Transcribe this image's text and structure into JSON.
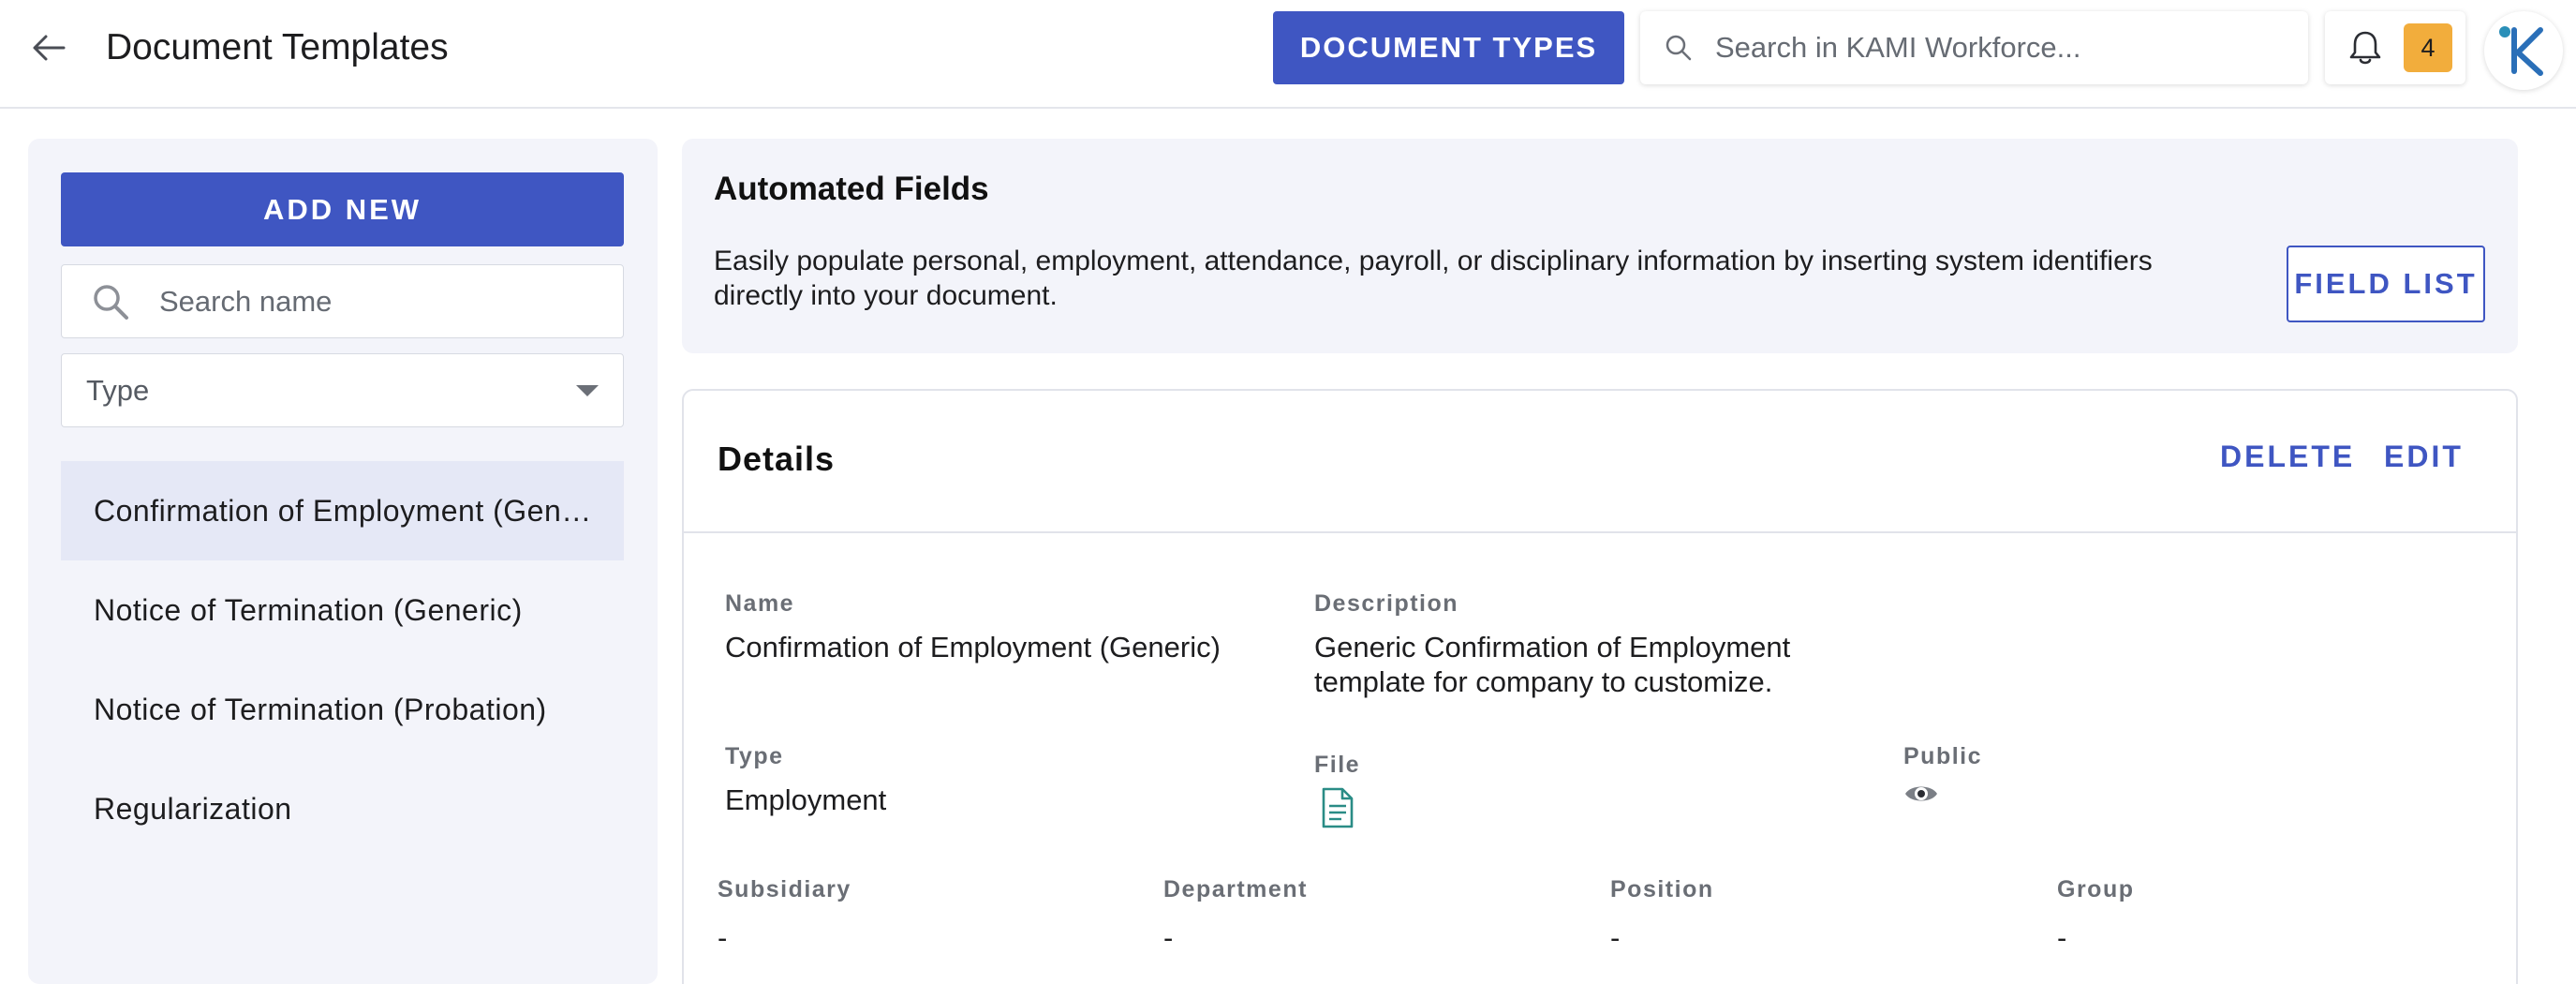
{
  "header": {
    "title": "Document Templates",
    "doc_types_label": "DOCUMENT TYPES",
    "search_placeholder": "Search in KAMI Workforce...",
    "notification_count": "4"
  },
  "sidebar": {
    "add_new_label": "ADD NEW",
    "search_placeholder": "Search name",
    "type_filter_label": "Type",
    "templates": [
      {
        "label": "Confirmation of Employment (Generic)",
        "active": true
      },
      {
        "label": "Notice of Termination (Generic)",
        "active": false
      },
      {
        "label": "Notice of Termination (Probation)",
        "active": false
      },
      {
        "label": "Regularization",
        "active": false
      }
    ]
  },
  "automated_fields": {
    "title": "Automated Fields",
    "description": "Easily populate personal, employment, attendance, payroll, or disciplinary information by inserting system identifiers directly into your document.",
    "field_list_label": "FIELD LIST"
  },
  "details": {
    "title": "Details",
    "delete_label": "DELETE",
    "edit_label": "EDIT",
    "name_label": "Name",
    "name_value": "Confirmation of Employment (Generic)",
    "description_label": "Description",
    "description_value": "Generic Confirmation of Employment template for company to customize.",
    "type_label": "Type",
    "type_value": "Employment",
    "file_label": "File",
    "public_label": "Public",
    "subsidiary_label": "Subsidiary",
    "subsidiary_value": "-",
    "department_label": "Department",
    "department_value": "-",
    "position_label": "Position",
    "position_value": "-",
    "group_label": "Group",
    "group_value": "-"
  },
  "colors": {
    "primary": "#3f56c2",
    "panel_bg": "#f3f4fa",
    "active_item_bg": "#e5e8f6",
    "badge": "#f2ad3c",
    "file_icon": "#2a8c86"
  },
  "icons": [
    "arrow-left-icon",
    "search-icon",
    "bell-icon",
    "kami-logo-icon",
    "chevron-down-icon",
    "document-file-icon",
    "eye-icon"
  ]
}
